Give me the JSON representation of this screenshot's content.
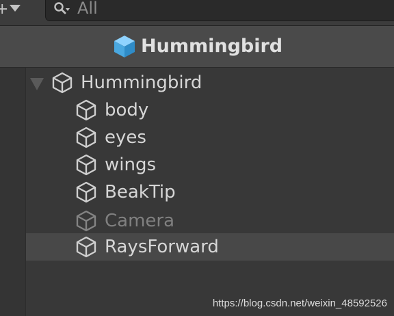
{
  "toolbar": {
    "create_plus": "+",
    "search": {
      "placeholder": "All",
      "value": ""
    }
  },
  "prefab_header": {
    "title": "Hummingbird",
    "icon": "prefab-cube-icon",
    "icon_color": "#5fb8ee"
  },
  "hierarchy": {
    "root": {
      "label": "Hummingbird",
      "expanded": true,
      "icon": "gameobject-cube-icon"
    },
    "children": [
      {
        "label": "body",
        "active": true,
        "selected": false,
        "icon": "gameobject-cube-icon"
      },
      {
        "label": "eyes",
        "active": true,
        "selected": false,
        "icon": "gameobject-cube-icon"
      },
      {
        "label": "wings",
        "active": true,
        "selected": false,
        "icon": "gameobject-cube-icon"
      },
      {
        "label": "BeakTip",
        "active": true,
        "selected": false,
        "icon": "gameobject-cube-icon"
      },
      {
        "label": "Camera",
        "active": false,
        "selected": false,
        "icon": "gameobject-cube-icon"
      },
      {
        "label": "RaysForward",
        "active": true,
        "selected": true,
        "icon": "gameobject-cube-icon"
      }
    ]
  },
  "watermark": "https://blog.csdn.net/weixin_48592526",
  "colors": {
    "panel_background": "#383838",
    "header_background": "#4a4a4a",
    "selected_row": "#484848",
    "text": "#d6d6d6",
    "inactive_text": "#808080"
  }
}
